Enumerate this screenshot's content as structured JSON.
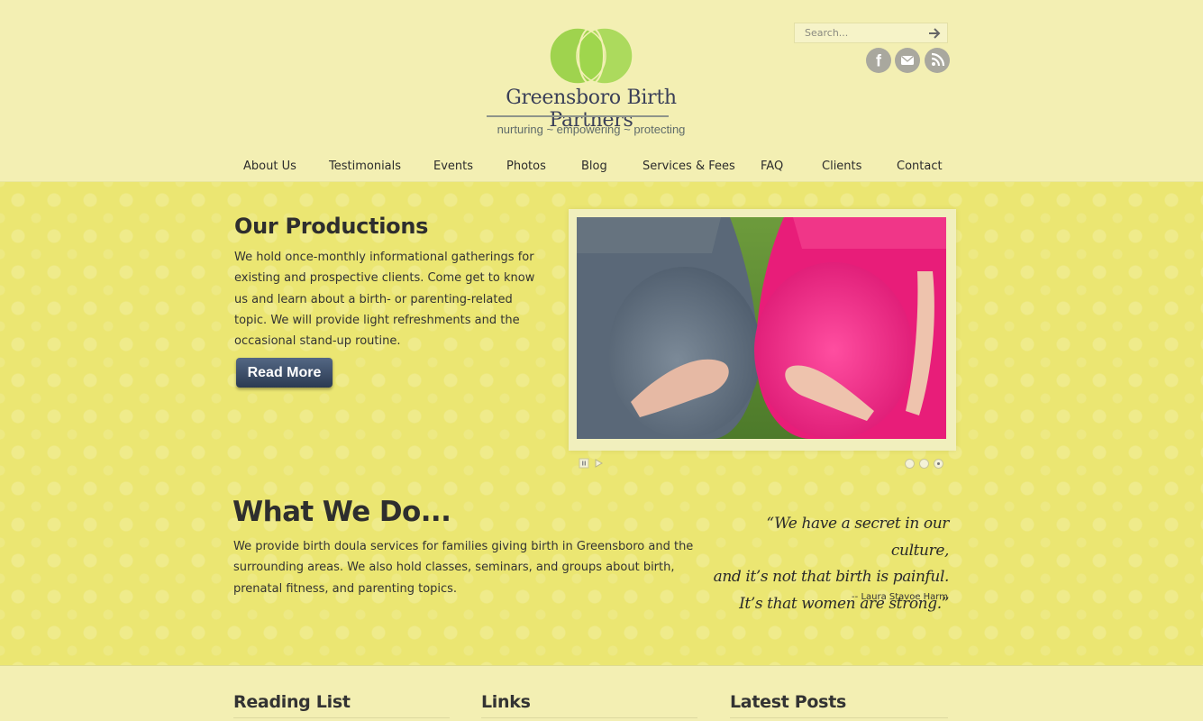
{
  "brand": {
    "name": "Greensboro Birth Partners",
    "tagline": "nurturing ~ empowering ~ protecting",
    "colors": {
      "logo_green": "#8fce3c",
      "logo_green_light": "#a8d960",
      "name_navy": "#3a3f58"
    }
  },
  "search": {
    "placeholder": "Search..."
  },
  "social": [
    {
      "name": "facebook-icon",
      "glyph": "f"
    },
    {
      "name": "email-icon",
      "glyph": "✉"
    },
    {
      "name": "rss-icon",
      "glyph": "rss"
    }
  ],
  "nav": {
    "items": [
      {
        "label": "About Us"
      },
      {
        "label": "Testimonials"
      },
      {
        "label": "Events"
      },
      {
        "label": "Photos"
      },
      {
        "label": "Blog"
      },
      {
        "label": "Services & Fees"
      },
      {
        "label": "FAQ"
      },
      {
        "label": "Clients"
      },
      {
        "label": "Contact"
      }
    ]
  },
  "feature": {
    "title": "Our Productions",
    "text": "We hold once-monthly informational gatherings for existing and prospective clients. Come get to know us and learn about a birth- or parenting-related topic. We will provide light refreshments and the occasional stand-up routine.",
    "button": "Read More"
  },
  "slider": {
    "controls": [
      "pause-icon",
      "play-icon"
    ],
    "slide_count": 3,
    "active_slide": 3
  },
  "about": {
    "title": "What We Do...",
    "text": "We provide birth doula services for families giving birth in Greensboro and the surrounding areas. We also hold classes, seminars, and groups about birth, prenatal fitness, and parenting topics."
  },
  "quote": {
    "line1": "“We have a secret in our culture,",
    "line2": "and it’s not that birth is painful.",
    "line3": "It’s that women are strong.”",
    "author": "-- Laura Stavoe Harm"
  },
  "footer": {
    "columns": [
      {
        "title": "Reading List"
      },
      {
        "title": "Links"
      },
      {
        "title": "Latest Posts"
      }
    ]
  }
}
